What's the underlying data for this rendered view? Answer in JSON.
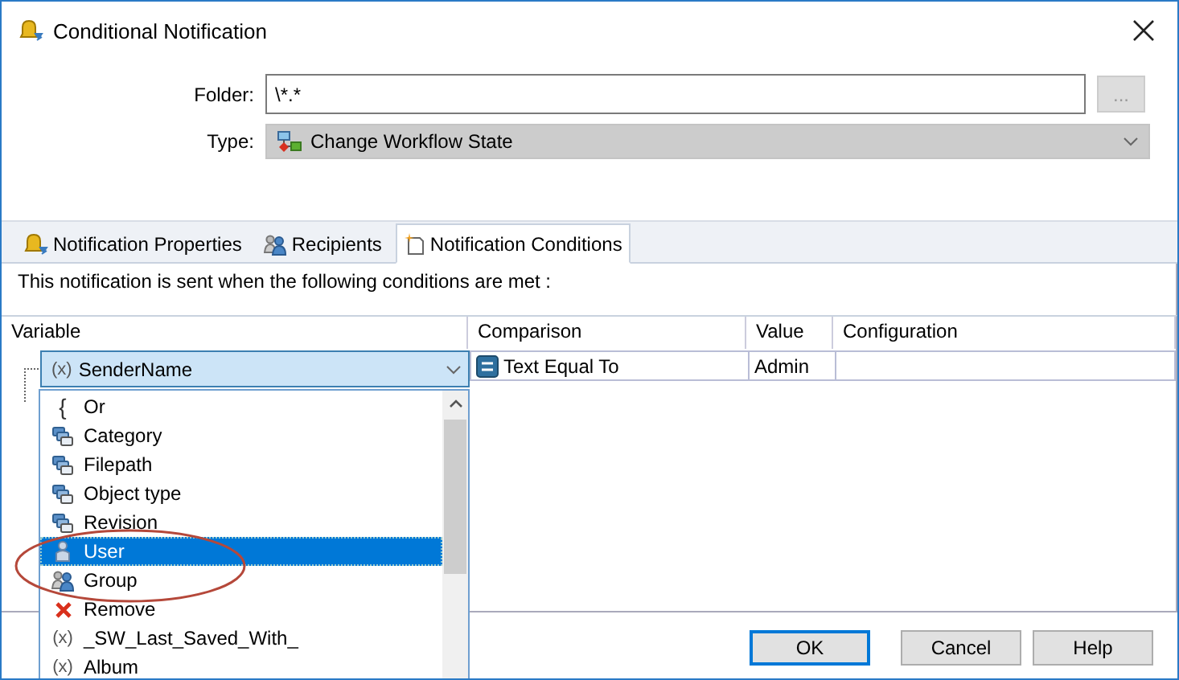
{
  "window": {
    "title": "Conditional Notification"
  },
  "form": {
    "folder": {
      "label": "Folder:",
      "value": "\\*.*",
      "browse_label": "...",
      "browse_disabled": true
    },
    "type": {
      "label": "Type:",
      "value": "Change Workflow State"
    }
  },
  "tabs": [
    {
      "label": "Notification Properties",
      "kind": "properties",
      "selected": false
    },
    {
      "label": "Recipients",
      "kind": "recipients",
      "selected": false
    },
    {
      "label": "Notification Conditions",
      "kind": "conditions",
      "selected": true
    }
  ],
  "description": "This notification is sent when the following conditions are met :",
  "table": {
    "columns": [
      "Variable",
      "Comparison",
      "Value",
      "Configuration"
    ],
    "rows": [
      {
        "variable_icon": "(x)",
        "variable": "SenderName",
        "comparison": "Text Equal To",
        "value": "Admin"
      }
    ]
  },
  "dropdown": {
    "items": [
      {
        "label": "Or",
        "kind": "brace",
        "glyph": "{",
        "selected": false
      },
      {
        "label": "Category",
        "kind": "attribute",
        "selected": false
      },
      {
        "label": "Filepath",
        "kind": "attribute",
        "selected": false
      },
      {
        "label": "Object type",
        "kind": "attribute",
        "selected": false
      },
      {
        "label": "Revision",
        "kind": "attribute",
        "selected": false
      },
      {
        "label": "User",
        "kind": "user",
        "selected": true
      },
      {
        "label": "Group",
        "kind": "group",
        "selected": false
      },
      {
        "label": "Remove",
        "kind": "remove",
        "selected": false
      },
      {
        "label": "_SW_Last_Saved_With_",
        "kind": "variable",
        "glyph": "(x)",
        "selected": false
      },
      {
        "label": "Album",
        "kind": "variable",
        "glyph": "(x)",
        "selected": false
      }
    ]
  },
  "buttons": [
    {
      "label": "OK",
      "default": true
    },
    {
      "label": "Cancel",
      "default": false
    },
    {
      "label": "Help",
      "default": false
    }
  ]
}
